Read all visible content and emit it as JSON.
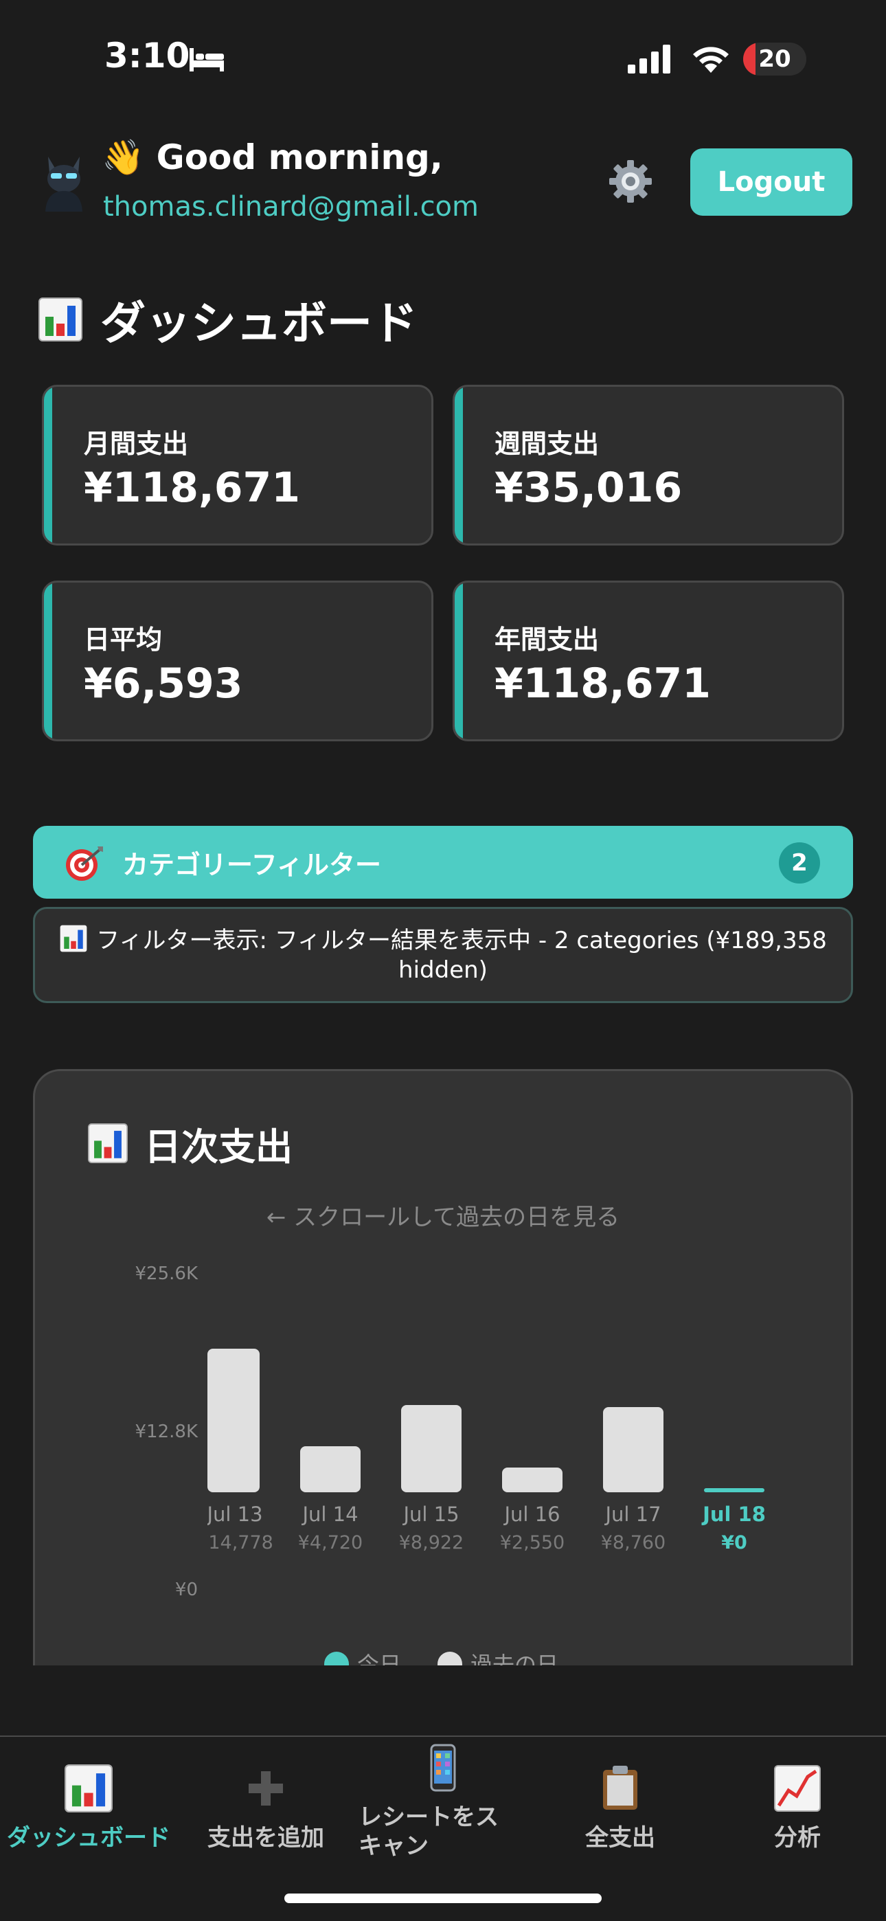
{
  "status_bar": {
    "time": "3:10",
    "battery": "20",
    "battery_level": 0.2
  },
  "header": {
    "greeting": "👋 Good morning,",
    "email": "thomas.clinard@gmail.com",
    "logout_label": "Logout",
    "settings_icon": "gear-icon"
  },
  "page_title": "ダッシュボード",
  "stats": [
    {
      "label": "月間支出",
      "value": "¥118,671"
    },
    {
      "label": "週間支出",
      "value": "¥35,016"
    },
    {
      "label": "日平均",
      "value": "¥6,593"
    },
    {
      "label": "年間支出",
      "value": "¥118,671"
    }
  ],
  "filter": {
    "label": "カテゴリーフィルター",
    "count": "2",
    "info": "フィルター表示: フィルター結果を表示中 - 2 categories (¥189,358 hidden)"
  },
  "chart_section": {
    "title": "日次支出",
    "hint": "← スクロールして過去の日を見る"
  },
  "chart_data": {
    "type": "bar",
    "title": "日次支出",
    "categories": [
      "Jul 13",
      "Jul 14",
      "Jul 15",
      "Jul 16",
      "Jul 17",
      "Jul 18"
    ],
    "value_labels": [
      "¥14,778",
      "¥4,720",
      "¥8,922",
      "¥2,550",
      "¥8,760",
      "¥0"
    ],
    "values": [
      14778,
      4720,
      8922,
      2550,
      8760,
      0
    ],
    "highlight_index": 5,
    "y_ticks": [
      "¥25.6K",
      "¥12.8K",
      "¥0"
    ],
    "ylim": [
      0,
      25600
    ],
    "legend": [
      {
        "name": "今日",
        "color": "#4ecdc4"
      },
      {
        "name": "過去の日",
        "color": "#e0e0e0"
      }
    ],
    "colors": {
      "past": "#e0e0e0",
      "today": "#4ecdc4"
    }
  },
  "nav": [
    {
      "label": "ダッシュボード",
      "icon": "bar-chart-icon",
      "active": true
    },
    {
      "label": "支出を追加",
      "icon": "plus-icon",
      "active": false
    },
    {
      "label": "レシートをスキャン",
      "icon": "phone-icon",
      "active": false
    },
    {
      "label": "全支出",
      "icon": "clipboard-icon",
      "active": false
    },
    {
      "label": "分析",
      "icon": "trend-chart-icon",
      "active": false
    }
  ],
  "colors": {
    "accent": "#4ecdc4",
    "background": "#1c1c1c",
    "card": "#2e2e2e"
  }
}
